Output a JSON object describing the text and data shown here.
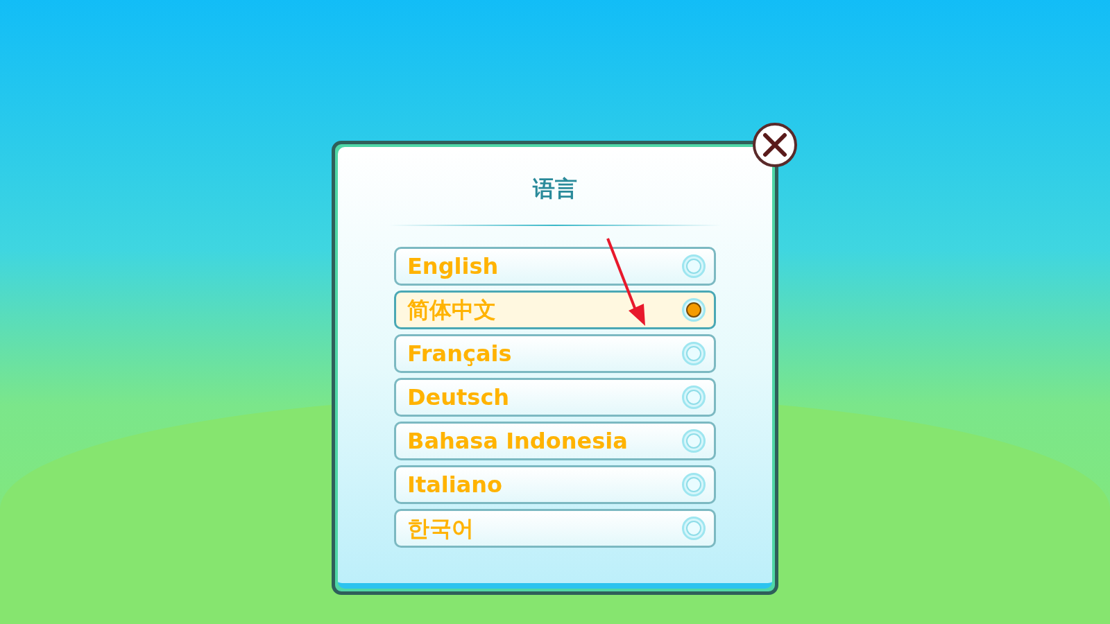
{
  "dialog": {
    "title": "语言",
    "languages": [
      {
        "label": "English",
        "selected": false
      },
      {
        "label": "简体中文",
        "selected": true
      },
      {
        "label": "Français",
        "selected": false
      },
      {
        "label": "Deutsch",
        "selected": false
      },
      {
        "label": "Bahasa Indonesia",
        "selected": false
      },
      {
        "label": "Italiano",
        "selected": false
      },
      {
        "label": "한국어",
        "selected": false
      }
    ]
  }
}
